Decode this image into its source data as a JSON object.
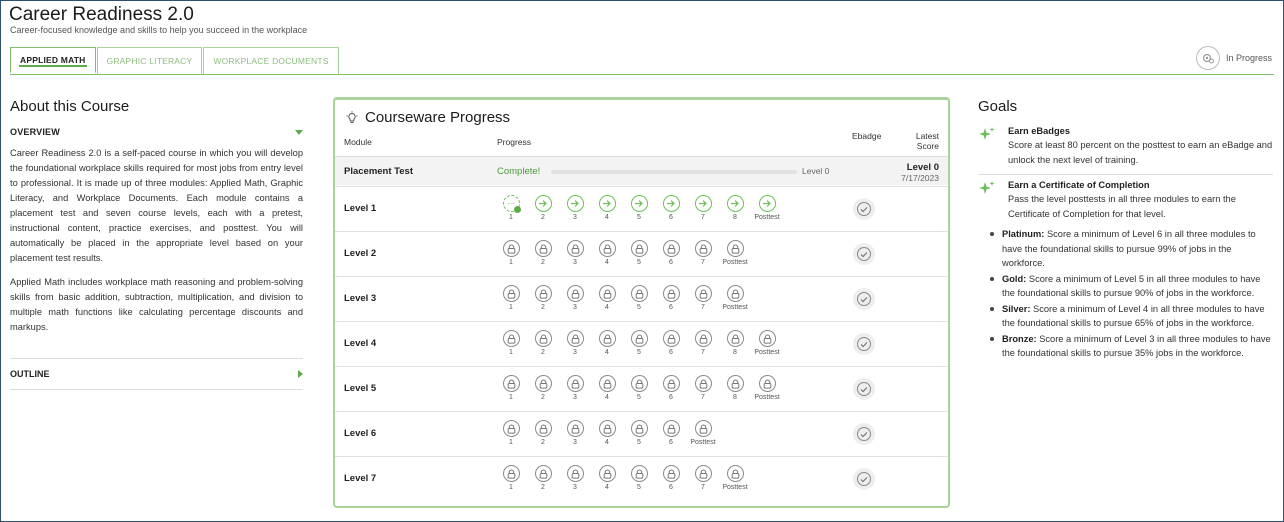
{
  "header": {
    "title": "Career Readiness 2.0",
    "subtitle": "Career-focused knowledge and skills to help you succeed in the workplace",
    "status": "In Progress"
  },
  "tabs": [
    {
      "label": "APPLIED MATH",
      "active": true
    },
    {
      "label": "GRAPHIC LITERACY",
      "active": false
    },
    {
      "label": "WORKPLACE DOCUMENTS",
      "active": false
    }
  ],
  "about": {
    "title": "About this Course",
    "overview_label": "OVERVIEW",
    "paragraphs": [
      "Career Readiness 2.0 is a self-paced course in which you will develop the foundational workplace skills required for most jobs from entry level to professional. It is made up of three modules: Applied Math, Graphic Literacy, and Workplace Documents. Each module contains a placement test and seven course levels, each with a pretest, instructional content, practice exercises, and posttest. You will automatically be placed in the appropriate level based on your placement test results.",
      "Applied Math includes workplace math reasoning and problem-solving skills from basic addition, subtraction, multiplication, and division to multiple math functions like calculating percentage discounts and markups."
    ],
    "outline_label": "OUTLINE"
  },
  "progress": {
    "title": "Courseware Progress",
    "col_module": "Module",
    "col_progress": "Progress",
    "col_ebadge": "Ebadge",
    "col_score_line1": "Latest",
    "col_score_line2": "Score",
    "placement": {
      "label": "Placement Test",
      "status": "Complete!",
      "bar_level": "Level 0",
      "score_level": "Level 0",
      "score_date": "7/17/2023"
    },
    "levels": [
      {
        "label": "Level 1",
        "lessons": [
          "1",
          "2",
          "3",
          "4",
          "5",
          "6",
          "7",
          "8",
          "Posttest"
        ],
        "state": "open"
      },
      {
        "label": "Level 2",
        "lessons": [
          "1",
          "2",
          "3",
          "4",
          "5",
          "6",
          "7",
          "Posttest"
        ],
        "state": "locked"
      },
      {
        "label": "Level 3",
        "lessons": [
          "1",
          "2",
          "3",
          "4",
          "5",
          "6",
          "7",
          "Posttest"
        ],
        "state": "locked"
      },
      {
        "label": "Level 4",
        "lessons": [
          "1",
          "2",
          "3",
          "4",
          "5",
          "6",
          "7",
          "8",
          "Posttest"
        ],
        "state": "locked"
      },
      {
        "label": "Level 5",
        "lessons": [
          "1",
          "2",
          "3",
          "4",
          "5",
          "6",
          "7",
          "8",
          "Posttest"
        ],
        "state": "locked"
      },
      {
        "label": "Level 6",
        "lessons": [
          "1",
          "2",
          "3",
          "4",
          "5",
          "6",
          "Posttest"
        ],
        "state": "locked"
      },
      {
        "label": "Level 7",
        "lessons": [
          "1",
          "2",
          "3",
          "4",
          "5",
          "6",
          "7",
          "Posttest"
        ],
        "state": "locked"
      }
    ]
  },
  "goals": {
    "title": "Goals",
    "ebadges_title": "Earn eBadges",
    "ebadges_text": "Score at least 80 percent on the posttest to earn an eBadge and unlock the next level of training.",
    "cert_title": "Earn a Certificate of Completion",
    "cert_text": "Pass the level posttests in all three modules to earn the Certificate of Completion for that level.",
    "tiers": [
      {
        "name": "Platinum:",
        "text": " Score a minimum of Level 6 in all three modules to have the foundational skills to pursue 99% of jobs in the workforce."
      },
      {
        "name": "Gold:",
        "text": " Score a minimum of Level 5 in all three modules to have the foundational skills to pursue 90% of jobs in the workforce."
      },
      {
        "name": "Silver:",
        "text": " Score a minimum of Level 4 in all three modules to have the foundational skills to pursue 65% of jobs in the workforce."
      },
      {
        "name": "Bronze:",
        "text": " Score a minimum of Level 3 in all three modules to have the foundational skills to pursue 35% jobs in the workforce."
      }
    ]
  },
  "colors": {
    "accent": "#5faa4a",
    "tab_border": "#a8d39a",
    "complete": "#4a9a38"
  },
  "icons": {
    "status": "settings-progress-icon",
    "bulb": "lightbulb-icon",
    "goal": "sparkle-icon",
    "lock": "lock-icon",
    "arrow": "arrow-right-icon",
    "badge": "check-badge-icon"
  }
}
